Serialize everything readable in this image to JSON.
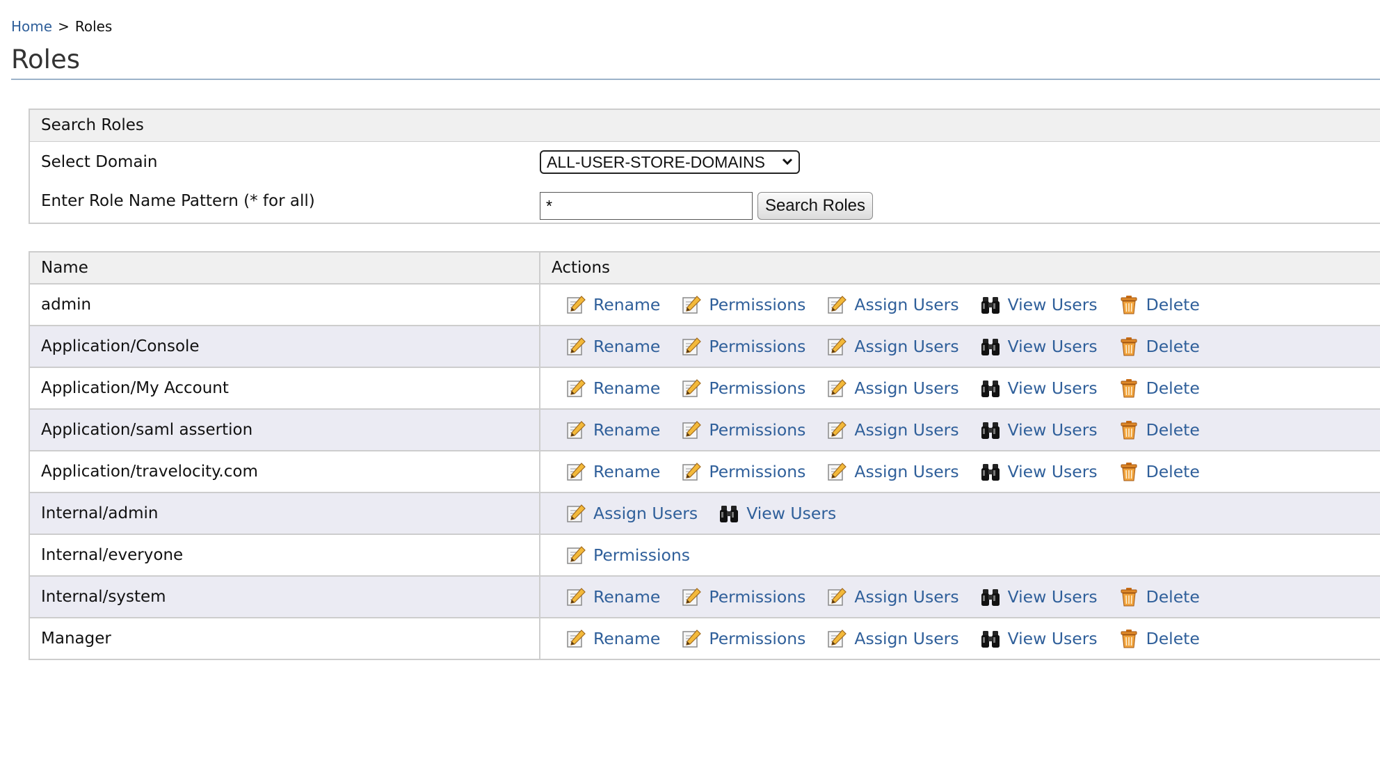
{
  "breadcrumb": {
    "home": "Home",
    "separator": ">",
    "current": "Roles"
  },
  "page": {
    "title": "Roles"
  },
  "search": {
    "header": "Search Roles",
    "domain_label": "Select Domain",
    "domain_value": "ALL-USER-STORE-DOMAINS",
    "pattern_label": "Enter Role Name Pattern (* for all)",
    "pattern_value": "*",
    "button_label": "Search Roles"
  },
  "table": {
    "col_name": "Name",
    "col_actions": "Actions",
    "action_labels": {
      "rename": "Rename",
      "permissions": "Permissions",
      "assign": "Assign Users",
      "view": "View Users",
      "delete": "Delete"
    },
    "action_icons": {
      "rename": "edit-pencil-icon",
      "permissions": "edit-pencil-icon",
      "assign": "edit-pencil-icon",
      "view": "binoculars-icon",
      "delete": "trash-bin-icon"
    },
    "rows": [
      {
        "name": "admin",
        "actions": [
          "rename",
          "permissions",
          "assign",
          "view",
          "delete"
        ]
      },
      {
        "name": "Application/Console",
        "actions": [
          "rename",
          "permissions",
          "assign",
          "view",
          "delete"
        ]
      },
      {
        "name": "Application/My Account",
        "actions": [
          "rename",
          "permissions",
          "assign",
          "view",
          "delete"
        ]
      },
      {
        "name": "Application/saml assertion",
        "actions": [
          "rename",
          "permissions",
          "assign",
          "view",
          "delete"
        ]
      },
      {
        "name": "Application/travelocity.com",
        "actions": [
          "rename",
          "permissions",
          "assign",
          "view",
          "delete"
        ]
      },
      {
        "name": "Internal/admin",
        "actions": [
          "assign",
          "view"
        ]
      },
      {
        "name": "Internal/everyone",
        "actions": [
          "permissions"
        ]
      },
      {
        "name": "Internal/system",
        "actions": [
          "rename",
          "permissions",
          "assign",
          "view",
          "delete"
        ]
      },
      {
        "name": "Manager",
        "actions": [
          "rename",
          "permissions",
          "assign",
          "view",
          "delete"
        ]
      }
    ]
  },
  "colors": {
    "link": "#2f5f9a",
    "header_bg": "#f0f0f0",
    "alt_row_bg": "#ebebf3",
    "border": "#cdcdcd"
  }
}
